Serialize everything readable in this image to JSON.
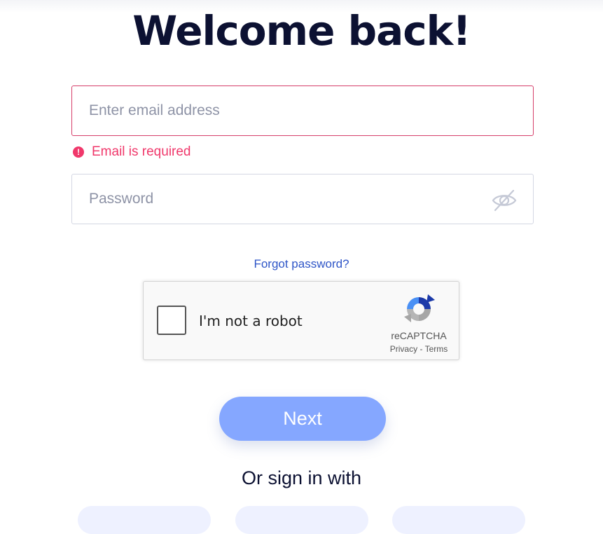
{
  "page": {
    "title": "Welcome back!"
  },
  "email": {
    "placeholder": "Enter email address",
    "value": "",
    "error": "Email is required"
  },
  "password": {
    "placeholder": "Password",
    "value": ""
  },
  "icons": {
    "error": "alert-circle-icon",
    "toggle_visibility": "eye-off-icon",
    "captcha": "recaptcha-logo-icon"
  },
  "forgot_password": "Forgot password?",
  "captcha": {
    "label": "I'm not a robot",
    "brand": "reCAPTCHA",
    "privacy": "Privacy",
    "separator": "-",
    "terms": "Terms"
  },
  "next_button": "Next",
  "social": {
    "heading": "Or sign in with",
    "buttons": [
      "",
      "",
      ""
    ]
  },
  "colors": {
    "title": "#0c1132",
    "error": "#f0386b",
    "link": "#2e55c7",
    "primary_button": "#85a7ff",
    "social_button": "#eef1ff"
  }
}
